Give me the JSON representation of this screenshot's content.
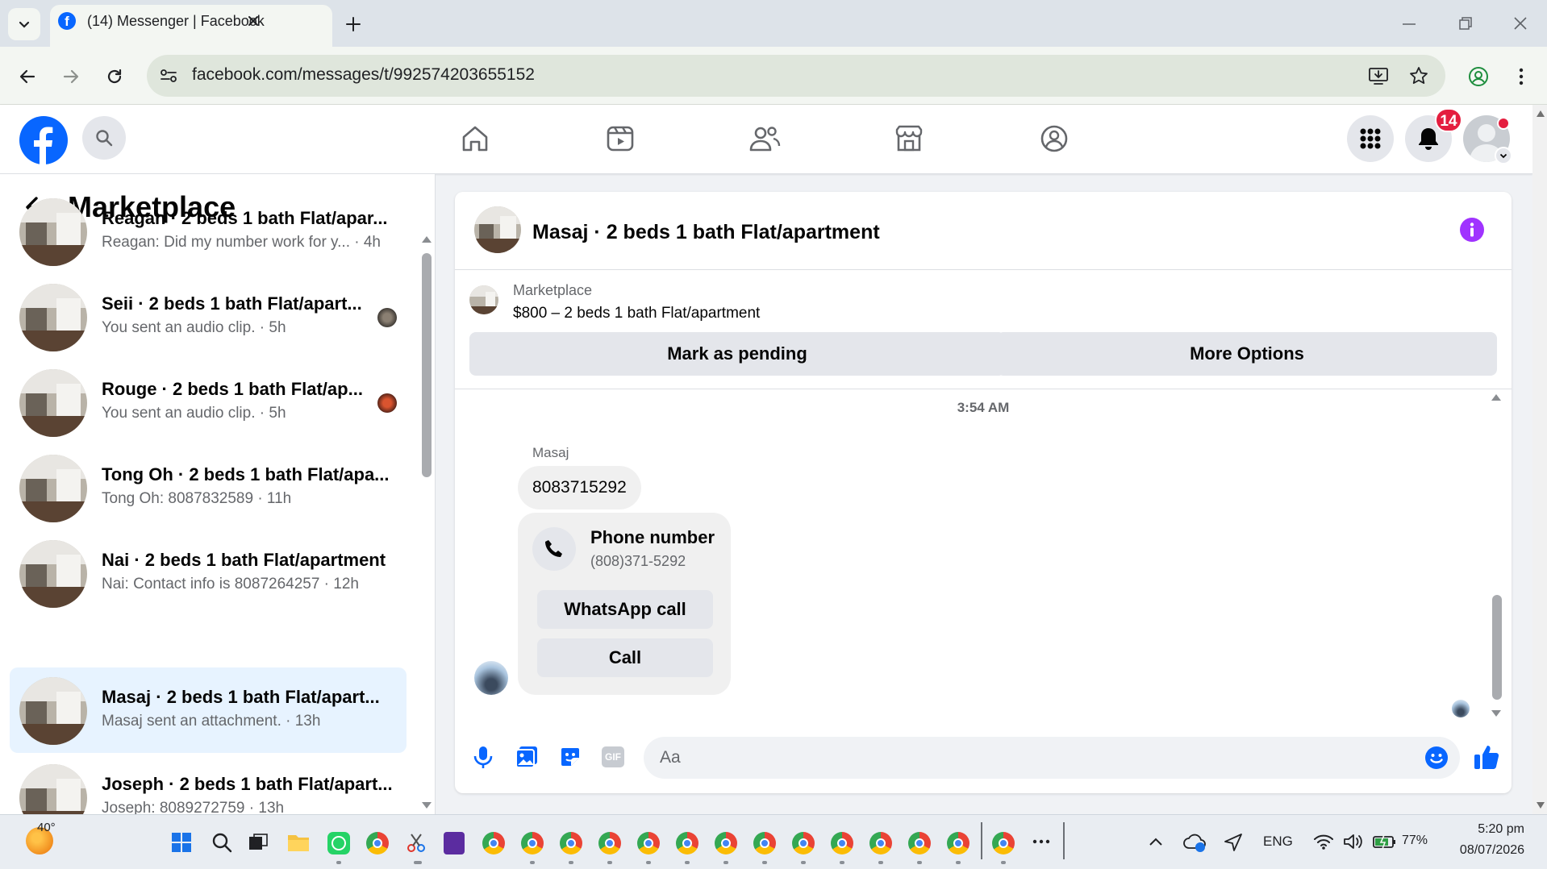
{
  "browser": {
    "tab_title": "(14) Messenger | Facebook",
    "url": "facebook.com/messages/t/992574203655152"
  },
  "header": {
    "notification_count": "14"
  },
  "sidebar": {
    "title": "Marketplace",
    "conversations": [
      {
        "title": "Reagan · 2 beds 1 bath Flat/apar...",
        "preview": "Reagan: Did my number work for y... · 4h"
      },
      {
        "title": "Seii · 2 beds 1 bath Flat/apart...",
        "preview": "You sent an audio clip. · 5h"
      },
      {
        "title": "Rouge · 2 beds 1 bath Flat/ap...",
        "preview": "You sent an audio clip. · 5h"
      },
      {
        "title": "Tong Oh · 2 beds 1 bath Flat/apa...",
        "preview": "Tong Oh: 8087832589 · 11h"
      },
      {
        "title": "Nai · 2 beds 1 bath Flat/apartment",
        "preview": "Nai: Contact info is 8087264257 · 12h"
      },
      {
        "title": "Masaj · 2 beds 1 bath Flat/apart...",
        "preview": "Masaj sent an attachment. · 13h"
      },
      {
        "title": "Joseph · 2 beds 1 bath Flat/apart...",
        "preview": "Joseph: 8089272759 · 13h"
      }
    ]
  },
  "chat": {
    "title": "Masaj · 2 beds 1 bath Flat/apartment",
    "listing_source": "Marketplace",
    "listing_text": "$800 – 2 beds 1 bath Flat/apartment",
    "mark_pending_label": "Mark as pending",
    "more_options_label": "More Options",
    "timestamp": "3:54 AM",
    "sender_name": "Masaj",
    "message_text": "8083715292",
    "card": {
      "title": "Phone number",
      "phone": "(808)371-5292",
      "whatsapp_label": "WhatsApp call",
      "call_label": "Call"
    },
    "composer_placeholder": "Aa"
  },
  "taskbar": {
    "weather_temp": "40°",
    "language": "ENG",
    "battery": "77%",
    "time": "5:20 pm",
    "date": "08/07/2026"
  },
  "colors": {
    "facebook_blue": "#0866ff",
    "active_conversation": "#e7f3ff",
    "badge_red": "#e41e3f",
    "info_purple": "#a033ff"
  }
}
